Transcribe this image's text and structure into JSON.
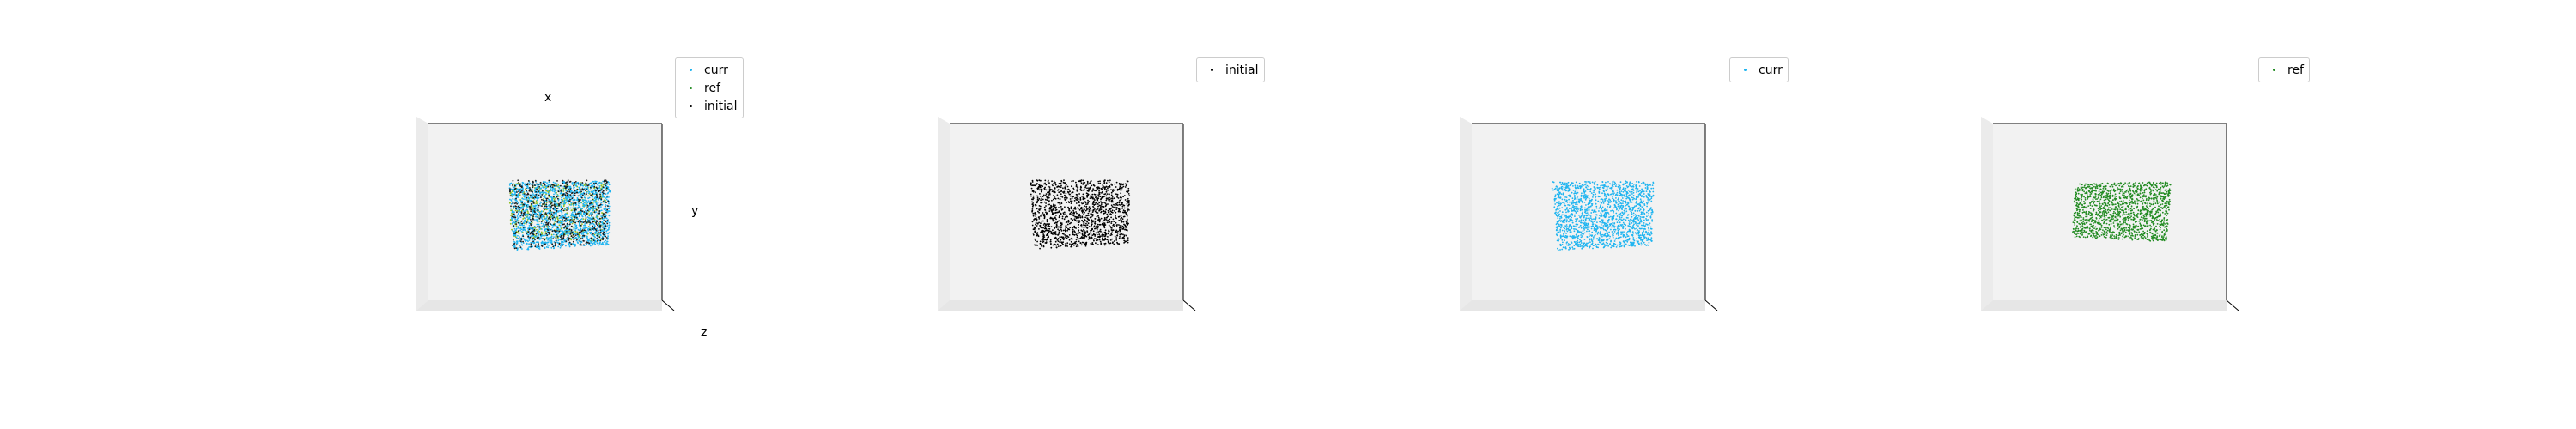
{
  "chart_data": [
    {
      "type": "scatter",
      "projection": "3d",
      "axis_labels": {
        "x": "x",
        "y": "y",
        "z": "z"
      },
      "legend_position": "top-right",
      "series": [
        {
          "name": "curr",
          "color": "#1eb4f0"
        },
        {
          "name": "ref",
          "color": "#228b22"
        },
        {
          "name": "initial",
          "color": "#000000"
        }
      ]
    },
    {
      "type": "scatter",
      "projection": "3d",
      "legend_position": "top-right",
      "series": [
        {
          "name": "initial",
          "color": "#000000"
        }
      ]
    },
    {
      "type": "scatter",
      "projection": "3d",
      "legend_position": "top-right",
      "series": [
        {
          "name": "curr",
          "color": "#1eb4f0"
        }
      ]
    },
    {
      "type": "scatter",
      "projection": "3d",
      "legend_position": "top-right",
      "series": [
        {
          "name": "ref",
          "color": "#228b22"
        }
      ]
    }
  ]
}
